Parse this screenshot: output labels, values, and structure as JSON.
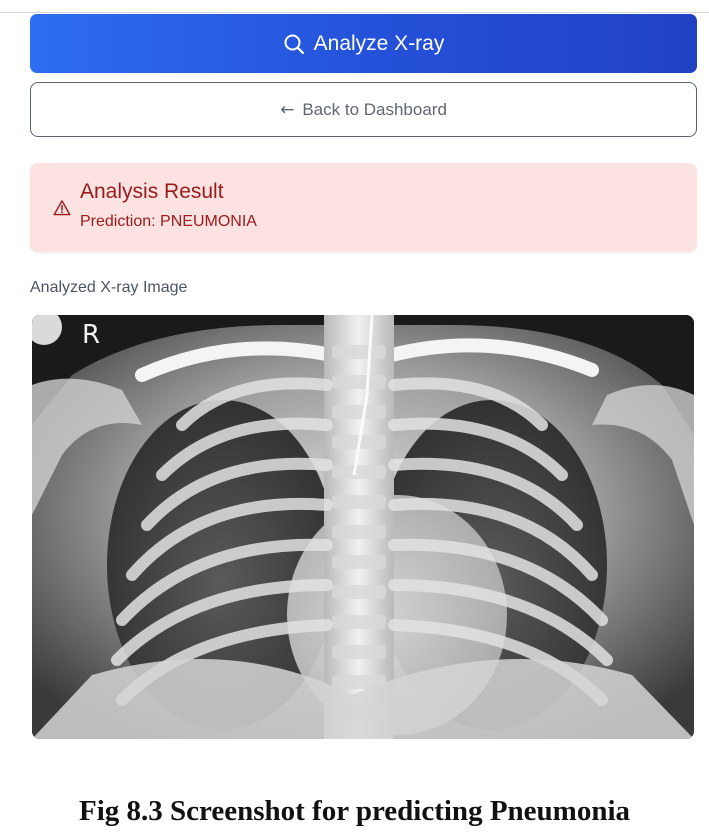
{
  "actions": {
    "analyze_label": "Analyze X-ray",
    "back_label": "Back to Dashboard"
  },
  "result": {
    "title": "Analysis Result",
    "prediction": "Prediction: PNEUMONIA"
  },
  "image_section": {
    "label": "Analyzed X-ray Image",
    "side_marker": "R"
  },
  "caption": "Fig 8.3 Screenshot for predicting Pneumonia",
  "icons": {
    "analyze": "search-icon",
    "back": "arrow-left-icon",
    "result": "warning-triangle-icon"
  },
  "colors": {
    "primary": "#2450d8",
    "result_bg": "#fde2e2",
    "result_text": "#991b1b"
  }
}
